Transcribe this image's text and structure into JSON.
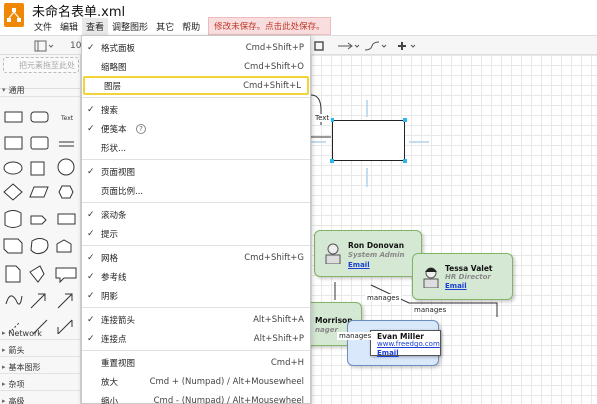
{
  "app": {
    "document_title": "未命名表单.xml",
    "menus": [
      "文件",
      "编辑",
      "查看",
      "调整图形",
      "其它",
      "帮助"
    ],
    "active_menu": "查看",
    "unsaved_notice": "修改未保存。点击此处保存。",
    "accent_color": "#f08705"
  },
  "toolbar": {
    "zoom_value": "10",
    "icons": [
      "page-view-icon",
      "connector-icon",
      "waypoint-icon",
      "add-icon"
    ]
  },
  "sidebar": {
    "drop_hint": "把元素拖至此处",
    "sections": {
      "general": "通用",
      "network": "Network",
      "arrows": "箭头",
      "basic": "基本图形",
      "misc": "杂项",
      "advanced": "高级"
    },
    "text_shape_label": "Text"
  },
  "view_menu": {
    "items": [
      {
        "check": "✓",
        "label": "格式面板",
        "shortcut": "Cmd+Shift+P"
      },
      {
        "check": "",
        "label": "缩略图",
        "shortcut": "Cmd+Shift+O"
      },
      {
        "check": "",
        "label": "图层",
        "shortcut": "Cmd+Shift+L"
      },
      {
        "check": "✓",
        "label": "搜索",
        "shortcut": ""
      },
      {
        "check": "✓",
        "label": "便笺本",
        "shortcut": ""
      },
      {
        "check": "",
        "label": "形状...",
        "shortcut": ""
      },
      {
        "check": "✓",
        "label": "页面视图",
        "shortcut": ""
      },
      {
        "check": "",
        "label": "页面比例...",
        "shortcut": ""
      },
      {
        "check": "✓",
        "label": "滚动条",
        "shortcut": ""
      },
      {
        "check": "✓",
        "label": "提示",
        "shortcut": ""
      },
      {
        "check": "✓",
        "label": "网格",
        "shortcut": "Cmd+Shift+G"
      },
      {
        "check": "✓",
        "label": "参考线",
        "shortcut": ""
      },
      {
        "check": "✓",
        "label": "阴影",
        "shortcut": ""
      },
      {
        "check": "✓",
        "label": "连接箭头",
        "shortcut": "Alt+Shift+A"
      },
      {
        "check": "✓",
        "label": "连接点",
        "shortcut": "Alt+Shift+P"
      },
      {
        "check": "",
        "label": "重置视图",
        "shortcut": "Cmd+H"
      },
      {
        "check": "",
        "label": "放大",
        "shortcut": "Cmd + (Numpad) / Alt+Mousewheel"
      },
      {
        "check": "",
        "label": "缩小",
        "shortcut": "Cmd - (Numpad) / Alt+Mousewheel"
      }
    ],
    "highlighted_item": "图层"
  },
  "diagram": {
    "text_label": "Text",
    "nodes": {
      "ron": {
        "name": "Ron Donovan",
        "role": "System Admin",
        "email": "Email"
      },
      "tessa": {
        "name": "Tessa Valet",
        "role": "HR Director",
        "email": "Email"
      },
      "morrison": {
        "name": "Morrison",
        "role": "nager"
      },
      "evan": {
        "name": "Evan Miller",
        "email": "Email",
        "link": "www.freedgo.com"
      }
    },
    "edge_labels": [
      "manages",
      "manages",
      "manages"
    ]
  }
}
